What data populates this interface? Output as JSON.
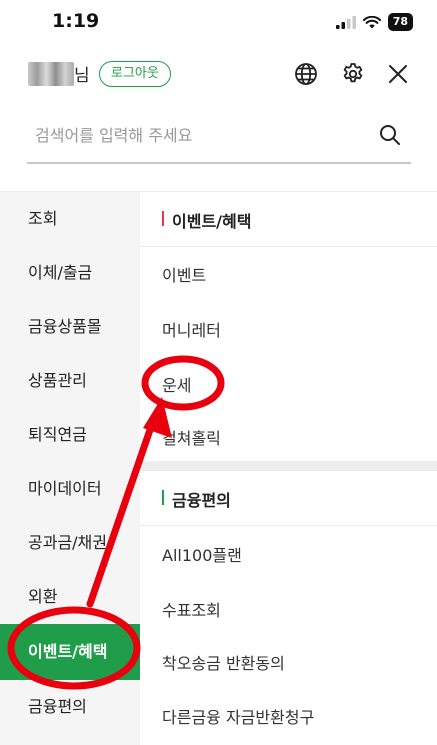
{
  "status": {
    "time": "1:19",
    "battery": "78"
  },
  "header": {
    "user_suffix": "님",
    "logout_label": "로그아웃"
  },
  "search": {
    "placeholder": "검색어를 입력해 주세요"
  },
  "left_menu": {
    "items": [
      {
        "label": "조회"
      },
      {
        "label": "이체/출금"
      },
      {
        "label": "금융상품몰"
      },
      {
        "label": "상품관리"
      },
      {
        "label": "퇴직연금"
      },
      {
        "label": "마이데이터"
      },
      {
        "label": "공과금/채권"
      },
      {
        "label": "외환"
      },
      {
        "label": "이벤트/혜택"
      },
      {
        "label": "금융편의"
      }
    ],
    "active_index": 8
  },
  "sections": [
    {
      "title": "이벤트/혜택",
      "accent": "#e8364f",
      "items": [
        "이벤트",
        "머니레터",
        "운세",
        "컬쳐홀릭"
      ]
    },
    {
      "title": "금융편의",
      "accent": "#1f9d4a",
      "items": [
        "All100플랜",
        "수표조회",
        "착오송금 반환동의",
        "다른금융 자금반환청구"
      ]
    }
  ],
  "colors": {
    "brand_green": "#1f9d4a",
    "annotation_red": "#e8000f"
  }
}
